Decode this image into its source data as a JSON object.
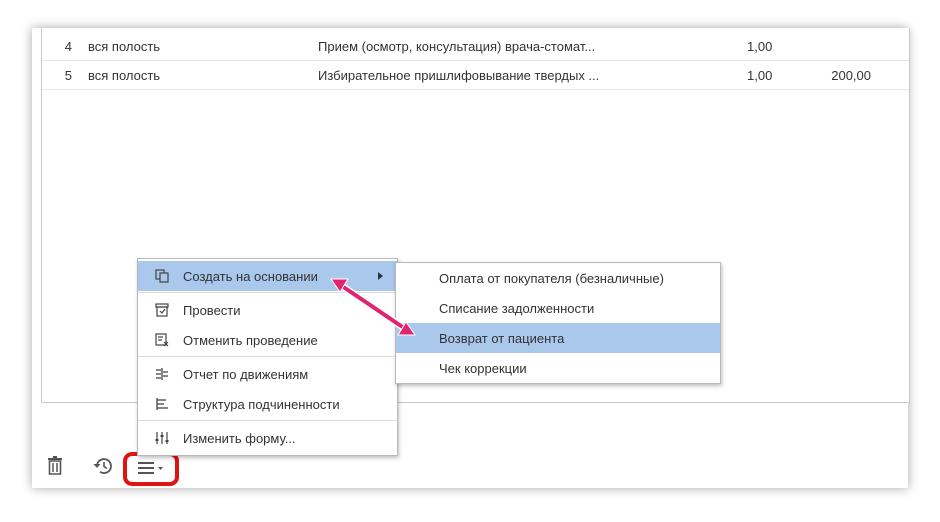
{
  "table": {
    "rows": [
      {
        "num": "4",
        "area": "вся полость",
        "service": "Прием (осмотр, консультация) врача-стомат...",
        "qty": "1,00",
        "sum": ""
      },
      {
        "num": "5",
        "area": "вся полость",
        "service": "Избирательное пришлифовывание твердых ...",
        "qty": "1,00",
        "sum": "200,00"
      }
    ]
  },
  "toolbar": {
    "delete_icon": "trash-icon",
    "history_icon": "history-icon",
    "menu_icon": "more-menu-icon"
  },
  "context_menu": {
    "items": [
      {
        "label": "Создать на основании",
        "icon": "copy-icon"
      },
      {
        "label": "Провести",
        "icon": "post-document-icon"
      },
      {
        "label": "Отменить проведение",
        "icon": "unpost-document-icon"
      },
      {
        "label": "Отчет по движениям",
        "icon": "movements-report-icon"
      },
      {
        "label": "Структура подчиненности",
        "icon": "hierarchy-icon"
      },
      {
        "label": "Изменить форму...",
        "icon": "form-settings-icon"
      }
    ]
  },
  "submenu": {
    "items": [
      {
        "label": "Оплата от покупателя (безналичные)"
      },
      {
        "label": "Списание задолженности"
      },
      {
        "label": "Возврат от пациента"
      },
      {
        "label": "Чек коррекции"
      }
    ]
  },
  "colors": {
    "highlight": "#a9c8ec",
    "annotation": "#e01313",
    "arrow": "#e0246f"
  }
}
